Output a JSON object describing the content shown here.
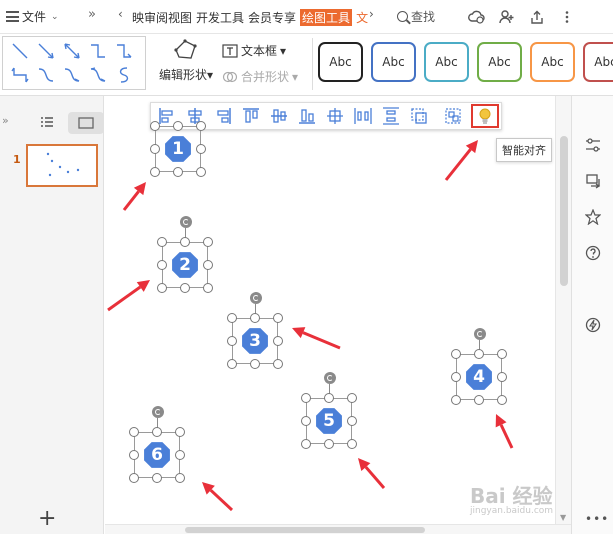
{
  "tabbar": {
    "file_label": "文件",
    "more_glyph": "»",
    "nav_left": "‹",
    "nav_right": "›",
    "tabs": [
      "映审阅视图",
      "开发工具",
      "会员专享"
    ],
    "active_tab": "绘图工具",
    "trunc_tab": "文",
    "search_label": "查找"
  },
  "ribbon": {
    "edit_shape_label": "编辑形状",
    "textbox_label": "文本框",
    "merge_label": "合并形状",
    "dropdown_glyph": "▾",
    "style_labels": [
      "Abc",
      "Abc",
      "Abc",
      "Abc",
      "Abc",
      "Abc"
    ],
    "style_colors": [
      "#222222",
      "#4472c4",
      "#4bacc6",
      "#70ad47",
      "#f79646",
      "#c0504d"
    ]
  },
  "left_panel": {
    "collapse_glyph": "»",
    "slide_number": "1",
    "add_glyph": "+"
  },
  "tooltip": {
    "smart_align": "智能对齐"
  },
  "shapes": {
    "badge_color": "#4a7fd8",
    "numbers": [
      "1",
      "2",
      "3",
      "4",
      "5",
      "6"
    ]
  },
  "watermark": {
    "text": "Bai 经验",
    "url": "jingyan.baidu.com"
  },
  "colors": {
    "accent": "#ec6a2f",
    "arrow": "#e8303a"
  }
}
